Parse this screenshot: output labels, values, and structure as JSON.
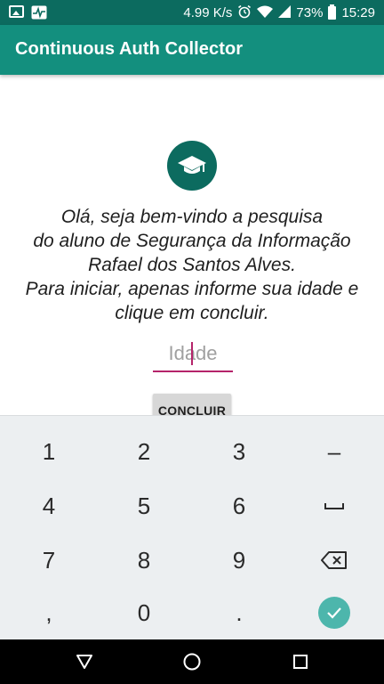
{
  "status_bar": {
    "speed": "4.99 K/s",
    "battery": "73%",
    "time": "15:29",
    "icons": [
      "image-icon",
      "pulse-icon",
      "alarm-icon",
      "wifi-icon",
      "signal-icon",
      "battery-icon"
    ]
  },
  "app": {
    "title": "Continuous Auth Collector",
    "primary_color": "#138f7e",
    "dark_color": "#0c6b5f",
    "accent_color": "#b5246a"
  },
  "main": {
    "logo_icon": "graduation-cap-icon",
    "welcome_lines": [
      "Olá, seja bem-vindo a pesquisa",
      "do aluno de Segurança da Informação",
      "Rafael dos Santos Alves.",
      "Para iniciar, apenas informe sua idade e",
      "clique em concluir."
    ],
    "age_field": {
      "value": "",
      "placeholder": "Idade"
    },
    "conclude_label": "CONCLUIR"
  },
  "keyboard": {
    "rows": [
      [
        "1",
        "2",
        "3",
        "–"
      ],
      [
        "4",
        "5",
        "6",
        "␣"
      ],
      [
        "7",
        "8",
        "9",
        "backspace"
      ],
      [
        ",",
        "0",
        ".",
        "done"
      ]
    ],
    "done_color": "#4db6ac"
  },
  "nav_bar": {
    "icons": [
      "back-icon",
      "home-icon",
      "recents-icon"
    ]
  }
}
